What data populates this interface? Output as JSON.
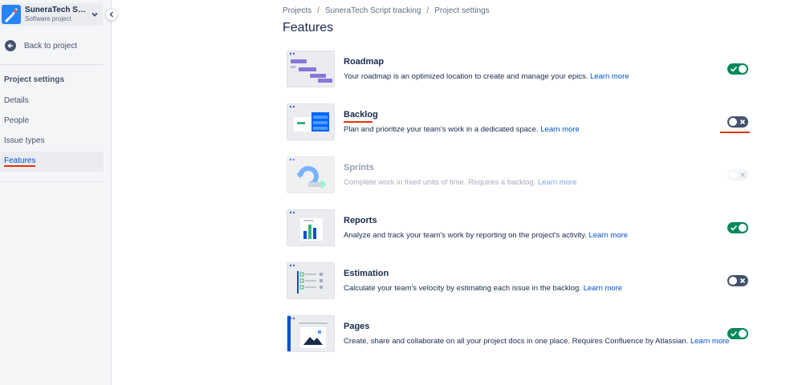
{
  "project": {
    "name": "SuneraTech Script tracking",
    "type": "Software project"
  },
  "sidebar": {
    "back_label": "Back to project",
    "section_title": "Project settings",
    "items": [
      {
        "label": "Details",
        "active": false
      },
      {
        "label": "People",
        "active": false
      },
      {
        "label": "Issue types",
        "active": false
      },
      {
        "label": "Features",
        "active": true
      }
    ]
  },
  "breadcrumbs": [
    "Projects",
    "SuneraTech Script tracking",
    "Project settings"
  ],
  "page_title": "Features",
  "features": [
    {
      "title": "Roadmap",
      "description": "Your roadmap is an optimized location to create and manage your epics.",
      "link": "Learn more",
      "state": "on"
    },
    {
      "title": "Backlog",
      "description": "Plan and prioritize your team's work in a dedicated space.",
      "link": "Learn more",
      "state": "off"
    },
    {
      "title": "Sprints",
      "description": "Complete work in fixed units of time. Requires a backlog.",
      "link": "Learn more",
      "state": "disabled"
    },
    {
      "title": "Reports",
      "description": "Analyze and track your team's work by reporting on the project's activity.",
      "link": "Learn more",
      "state": "on"
    },
    {
      "title": "Estimation",
      "description": "Calculate your team's velocity by estimating each issue in the backlog.",
      "link": "Learn more",
      "state": "off"
    },
    {
      "title": "Pages",
      "description": "Create, share and collaborate on all your project docs in one place. Requires Confluence by Atlassian.",
      "link": "Learn more",
      "state": "on"
    }
  ],
  "colors": {
    "toggle_on": "#00875a",
    "toggle_off": "#42526e",
    "link": "#0052cc",
    "highlight_underline": "#de350b"
  }
}
